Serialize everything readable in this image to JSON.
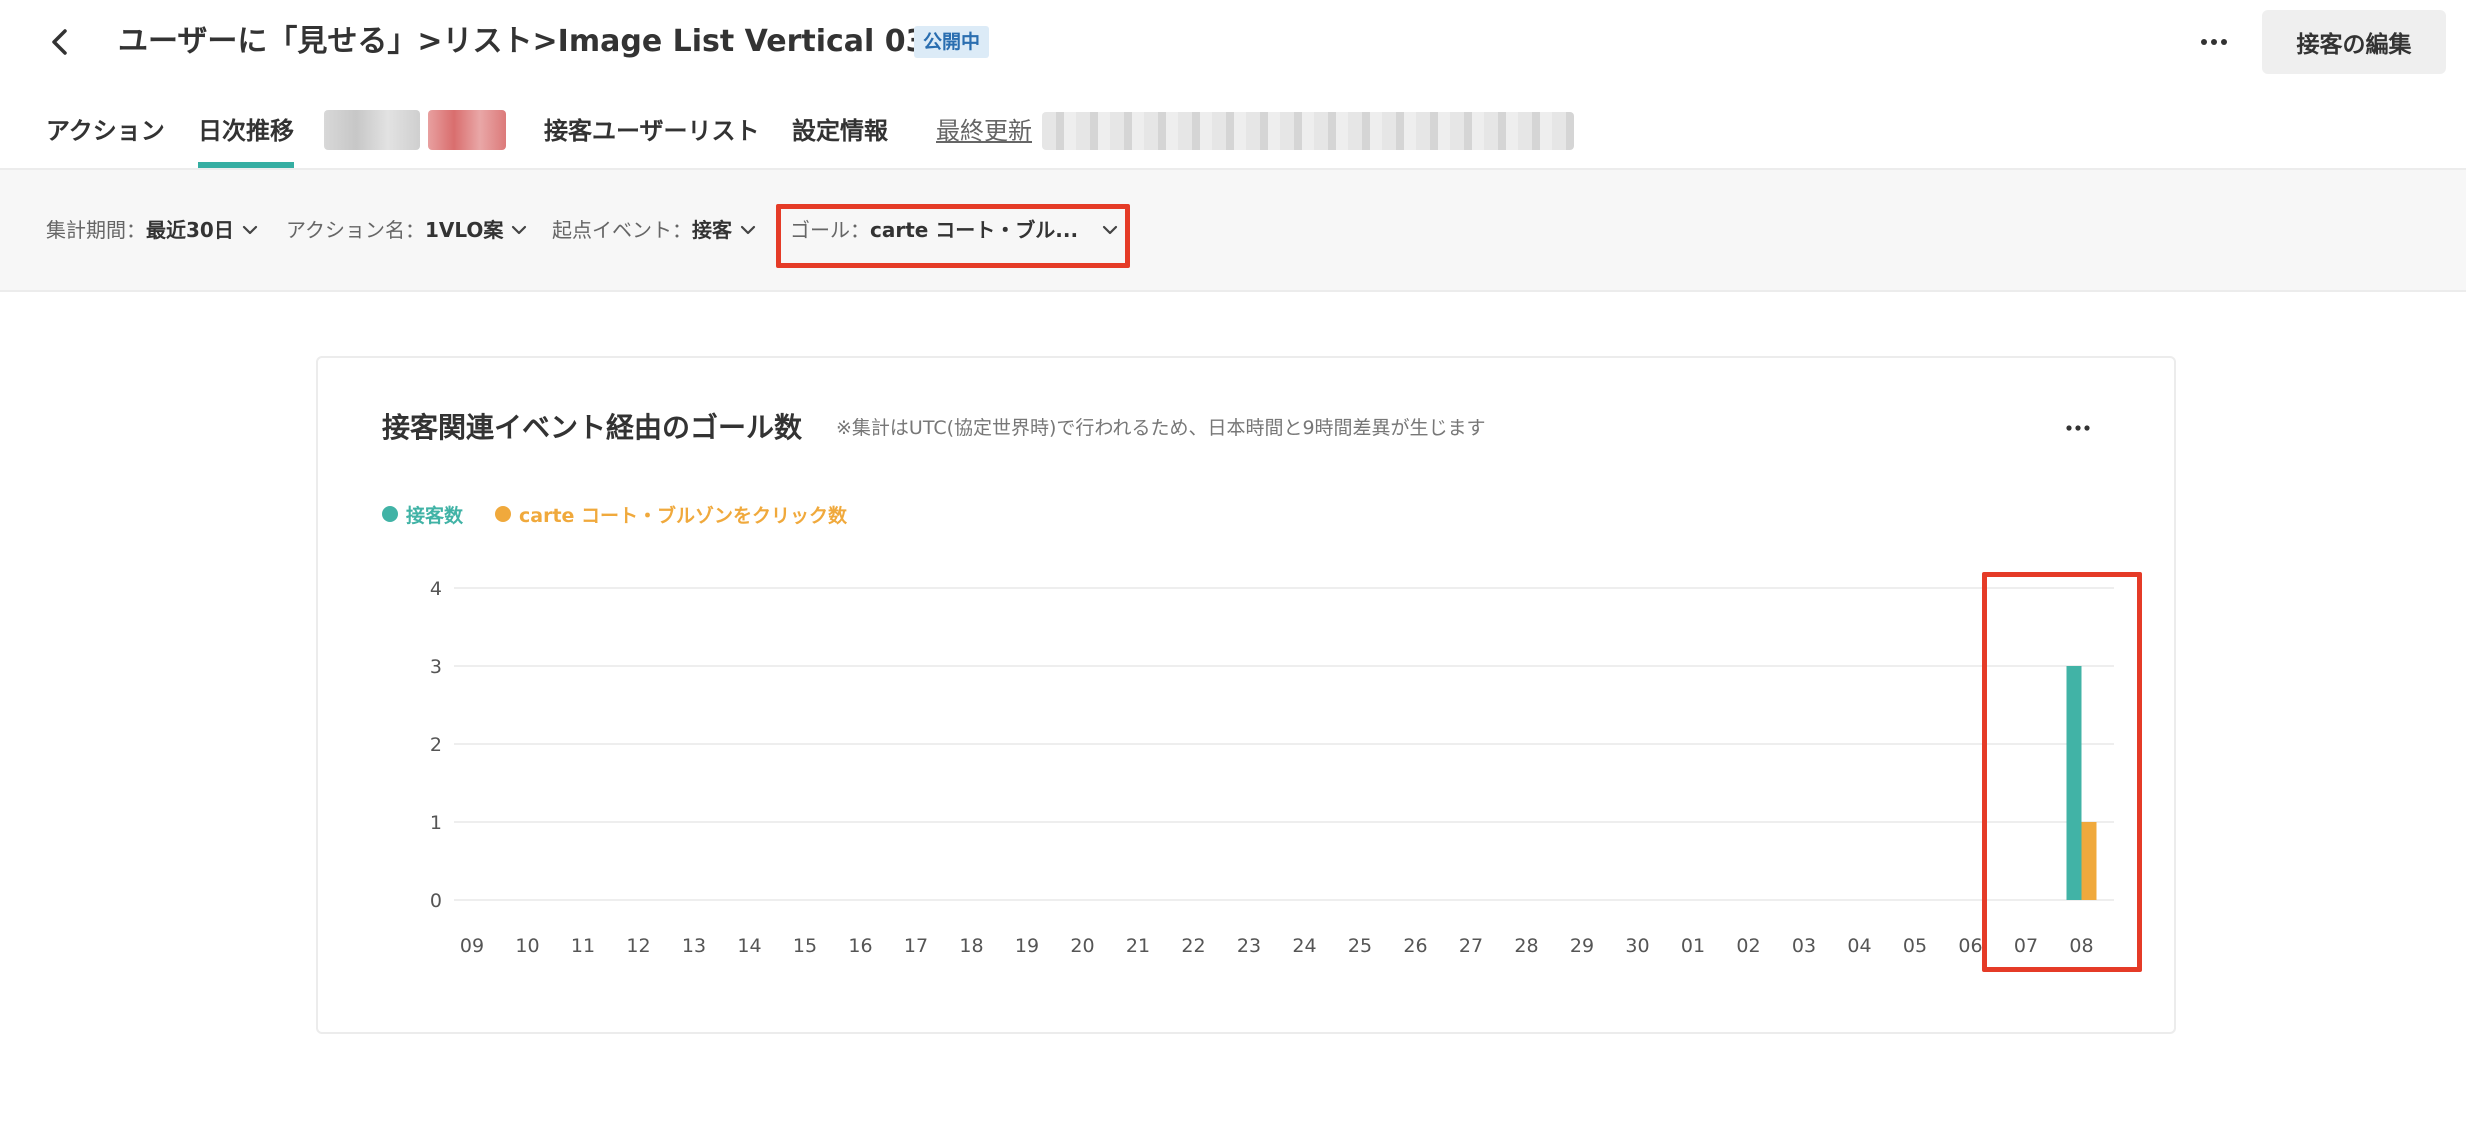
{
  "header": {
    "title": "ユーザーに「見せる」>リスト>Image List Vertical 03",
    "status": "公開中",
    "edit_label": "接客の編集"
  },
  "tabs": {
    "items": [
      {
        "label": "アクション"
      },
      {
        "label": "日次推移"
      },
      {
        "label": "接客ユーザーリスト"
      },
      {
        "label": "設定情報"
      }
    ],
    "last_updated_label": "最終更新"
  },
  "filters": [
    {
      "label": "集計期間：",
      "value": "最近30日"
    },
    {
      "label": "アクション名：",
      "value": "1VLO案"
    },
    {
      "label": "起点イベント：",
      "value": "接客"
    },
    {
      "label": "ゴール：",
      "value": "carte コート・ブル..."
    }
  ],
  "chart_card": {
    "title": "接客関連イベント経由のゴール数",
    "note": "※集計はUTC(協定世界時)で行われるため、日本時間と9時間差異が生じます"
  },
  "colors": {
    "accent": "#35aea2",
    "series_a": "#41b3a6",
    "series_b": "#f0a93c",
    "highlight": "#e53b27"
  },
  "chart_data": {
    "type": "bar",
    "categories": [
      "09",
      "10",
      "11",
      "12",
      "13",
      "14",
      "15",
      "16",
      "17",
      "18",
      "19",
      "20",
      "21",
      "22",
      "23",
      "24",
      "25",
      "26",
      "27",
      "28",
      "29",
      "30",
      "01",
      "02",
      "03",
      "04",
      "05",
      "06",
      "07",
      "08"
    ],
    "series": [
      {
        "name": "接客数",
        "values": [
          0,
          0,
          0,
          0,
          0,
          0,
          0,
          0,
          0,
          0,
          0,
          0,
          0,
          0,
          0,
          0,
          0,
          0,
          0,
          0,
          0,
          0,
          0,
          0,
          0,
          0,
          0,
          0,
          0,
          3
        ]
      },
      {
        "name": "carte コート・ブルゾンをクリック数",
        "values": [
          0,
          0,
          0,
          0,
          0,
          0,
          0,
          0,
          0,
          0,
          0,
          0,
          0,
          0,
          0,
          0,
          0,
          0,
          0,
          0,
          0,
          0,
          0,
          0,
          0,
          0,
          0,
          0,
          0,
          1
        ]
      }
    ],
    "yticks": [
      0,
      1,
      2,
      3,
      4
    ],
    "ylim": [
      0,
      4
    ],
    "grid": true,
    "legend": "top-left"
  }
}
